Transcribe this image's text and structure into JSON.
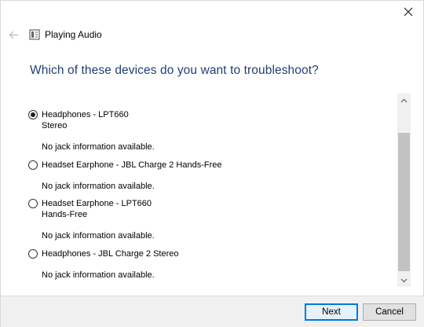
{
  "window": {
    "nav_title": "Playing Audio",
    "heading": "Which of these devices do you want to troubleshoot?"
  },
  "icons": {
    "close": "close-icon",
    "back": "back-arrow-icon",
    "app": "troubleshooter-icon"
  },
  "devices": [
    {
      "name": "Headphones - LPT660",
      "subtitle": "Stereo",
      "jack": "No jack information available.",
      "selected": true
    },
    {
      "name": "Headset Earphone - JBL Charge 2 Hands-Free",
      "subtitle": "",
      "jack": "No jack information available.",
      "selected": false
    },
    {
      "name": "Headset Earphone - LPT660",
      "subtitle": "Hands-Free",
      "jack": "No jack information available.",
      "selected": false
    },
    {
      "name": "Headphones - JBL Charge 2 Stereo",
      "subtitle": "",
      "jack": "No jack information available.",
      "selected": false
    }
  ],
  "footer": {
    "next_label": "Next",
    "cancel_label": "Cancel"
  },
  "colors": {
    "heading": "#1f3f73",
    "primary_border": "#0078d7",
    "footer_bg": "#f0f0f0"
  }
}
